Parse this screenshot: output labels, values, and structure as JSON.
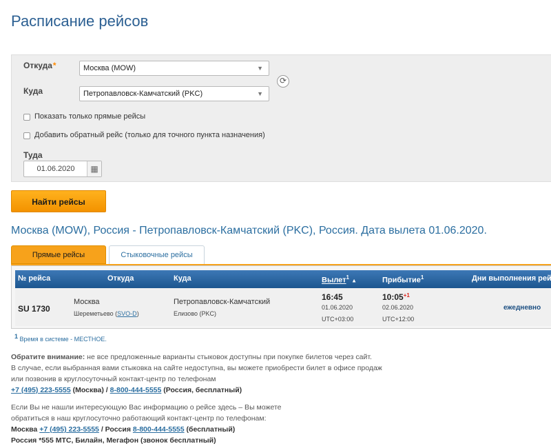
{
  "page": {
    "title": "Расписание рейсов"
  },
  "form": {
    "from_label": "Откуда",
    "required_mark": "*",
    "from_value": "Москва (MOW)",
    "to_label": "Куда",
    "to_value": "Петропавловск-Камчатский (PKC)",
    "direct_only_label": "Показать только прямые рейсы",
    "direct_only_checked": false,
    "add_return_label": "Добавить обратный рейс (только для точного пункта назначения)",
    "add_return_checked": false,
    "date_label": "Туда",
    "date_value": "01.06.2020",
    "search_button": "Найти рейсы"
  },
  "results": {
    "title": "Москва (MOW), Россия - Петропавловск-Камчатский (PKC), Россия. Дата вылета 01.06.2020.",
    "tabs": [
      {
        "label": "Прямые рейсы",
        "active": true
      },
      {
        "label": "Стыковочные рейсы",
        "active": false
      }
    ],
    "columns": {
      "flight_no": "№ рейса",
      "from": "Откуда",
      "to": "Куда",
      "departure": "Вылет",
      "departure_sup": "1",
      "departure_sort": "▲",
      "arrival": "Прибытие",
      "arrival_sup": "1",
      "days": "Дни выполнения рейса"
    },
    "rows": [
      {
        "flight_no": "SU 1730",
        "from_city": "Москва",
        "from_airport": "Шереметьево (",
        "from_airport_code": "SVO-D",
        "from_airport_close": ")",
        "to_city": "Петропавловск-Камчатский",
        "to_airport": "Елизово (PKC)",
        "dep_time": "16:45",
        "dep_date": "01.06.2020",
        "dep_tz": "UTC+03:00",
        "arr_time": "10:05",
        "arr_day_offset": "+1",
        "arr_date": "02.06.2020",
        "arr_tz": "UTC+12:00",
        "days": "ежедневно"
      }
    ],
    "footnote_mark": "1",
    "footnote_text": "Время в системе - МЕСТНОЕ."
  },
  "notice": {
    "attention_label": "Обратите внимание:",
    "line1": " не все предложенные варианты стыковок доступны при покупке билетов через сайт.",
    "line2": "В случае, если выбранная вами стыковка на сайте недоступна, вы можете приобрести билет в офисе продаж",
    "line3": "или позвонив в круглосуточный контакт-центр по телефонам",
    "phone_moscow": "+7 (495) 223-5555",
    "moscow_suffix": " (Москва) / ",
    "phone_russia": "8-800-444-5555",
    "russia_suffix": " (Россия, бесплатный)"
  },
  "contact": {
    "line1": "Если Вы не нашли интересующую Вас информацию о рейсе здесь – Вы можете",
    "line2": "обратиться в наш круглосуточно работающий контакт-центр по телефонам:",
    "moscow_label": "Москва",
    "phone_moscow": "+7 (495) 223-5555",
    "russia_label": "Россия",
    "phone_russia": "8-800-444-5555",
    "free_suffix": " (бесплатный)",
    "short_line": "Россия *555 МТС, Билайн, Мегафон (звонок бесплатный)"
  },
  "colors": {
    "title_blue": "#2b5f92",
    "accent_orange": "#f7a21b",
    "table_header_blue": "#1d568f"
  }
}
